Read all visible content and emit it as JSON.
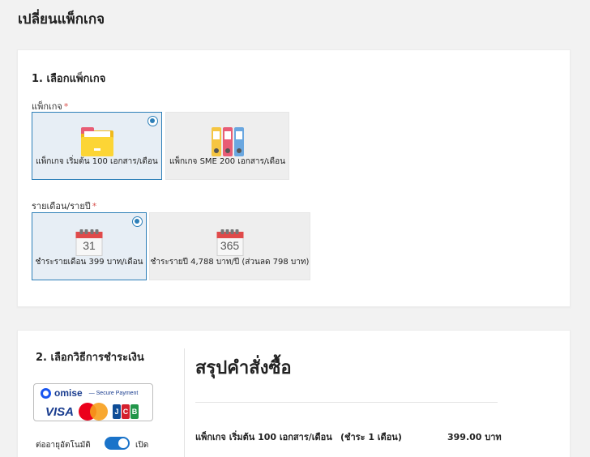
{
  "page": {
    "title": "เปลี่ยนแพ็กเกจ"
  },
  "step1": {
    "title": "1. เลือกแพ็กเกจ",
    "package_label": "แพ็กเกจ",
    "required_mark": "*",
    "packages": [
      {
        "label": "แพ็กเกจ เริ่มต้น 100 เอกสาร/เดือน",
        "icon": "folder-icon",
        "selected": true
      },
      {
        "label": "แพ็กเกจ SME 200 เอกสาร/เดือน",
        "icon": "binders-icon",
        "selected": false
      }
    ],
    "billing_label": "รายเดือน/รายปี",
    "billing": [
      {
        "label": "ชำระรายเดือน 399 บาท/เดือน",
        "icon": "calendar-icon",
        "day": "31",
        "selected": true
      },
      {
        "label": "ชำระรายปี 4,788 บาท/ปี (ส่วนลด 798 บาท)",
        "icon": "calendar-icon",
        "day": "365",
        "selected": false
      }
    ]
  },
  "step2": {
    "title": "2. เลือกวิธีการชำระเงิน",
    "omise": {
      "brand": "omise",
      "secure_text": "— Secure Payment",
      "visa": "VISA",
      "jcb": [
        "J",
        "C",
        "B"
      ]
    },
    "auto_renew_label": "ต่ออายุอัตโนมัติ",
    "auto_renew_state": "เปิด",
    "auto_renew_on": true
  },
  "summary": {
    "title": "สรุปคำสั่งซื้อ",
    "item": "แพ็กเกจ เริ่มต้น 100 เอกสาร/เดือน",
    "period": "(ชำระ 1 เดือน)",
    "price": "399.00 บาท"
  },
  "colors": {
    "accent": "#2d7fb8",
    "toggle": "#1a73c9",
    "required": "#d9534f"
  }
}
